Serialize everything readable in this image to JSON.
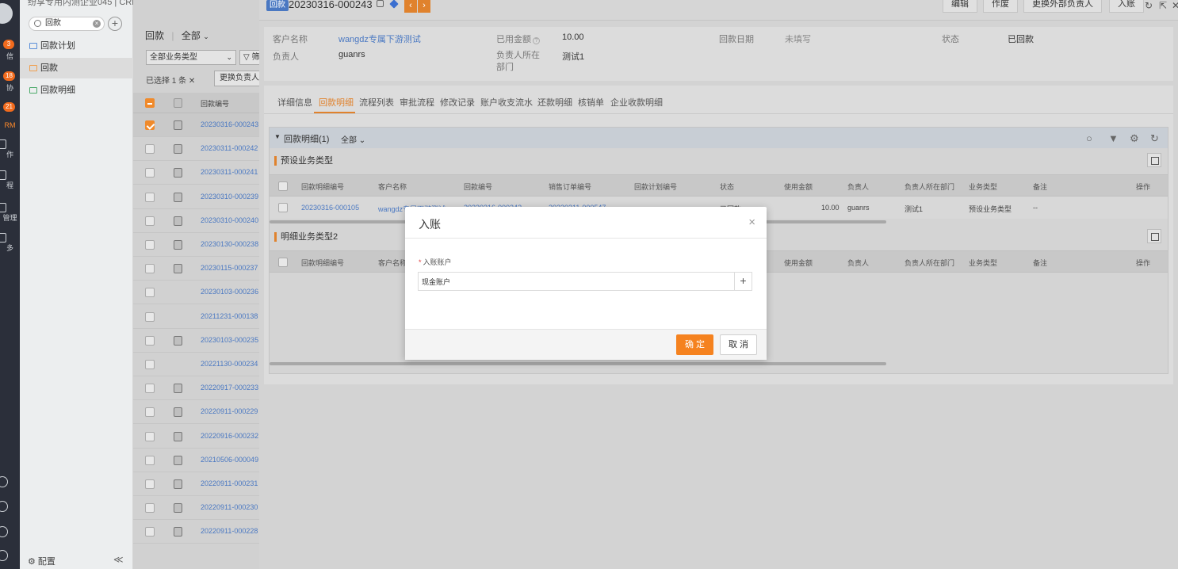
{
  "rail": {
    "items": [
      {
        "label": "信",
        "badge": "3"
      },
      {
        "label": "协",
        "badge": "18"
      },
      {
        "label": "RM",
        "badge": "21"
      },
      {
        "label": "作",
        "badge": ""
      },
      {
        "label": "程",
        "badge": ""
      },
      {
        "label": "管理",
        "badge": ""
      },
      {
        "label": "多",
        "badge": ""
      }
    ]
  },
  "nav": {
    "crumb": "纷享专用内测企业045  |  CRM",
    "search_value": "回款",
    "items": [
      {
        "label": "回款计划"
      },
      {
        "label": "回款"
      },
      {
        "label": "回款明细"
      }
    ],
    "config_label": "配置",
    "collapse_label": "≪"
  },
  "list": {
    "header_title": "回款",
    "scope": "全部",
    "type_select": "全部业务类型",
    "filter_label": "筛",
    "selected_text": "已选择 1 条",
    "change_owner": "更换负责人",
    "column": "回款编号",
    "rows": [
      {
        "no": "20230316-000243",
        "checked": true,
        "clip": true
      },
      {
        "no": "20230311-000242",
        "checked": false,
        "clip": true
      },
      {
        "no": "20230311-000241",
        "checked": false,
        "clip": true
      },
      {
        "no": "20230310-000239",
        "checked": false,
        "clip": true
      },
      {
        "no": "20230310-000240",
        "checked": false,
        "clip": true
      },
      {
        "no": "20230130-000238",
        "checked": false,
        "clip": true
      },
      {
        "no": "20230115-000237",
        "checked": false,
        "clip": true
      },
      {
        "no": "20230103-000236",
        "checked": false,
        "clip": false
      },
      {
        "no": "20211231-000138",
        "checked": false,
        "clip": false
      },
      {
        "no": "20230103-000235",
        "checked": false,
        "clip": true
      },
      {
        "no": "20221130-000234",
        "checked": false,
        "clip": false
      },
      {
        "no": "20220917-000233",
        "checked": false,
        "clip": true
      },
      {
        "no": "20220911-000229",
        "checked": false,
        "clip": true
      },
      {
        "no": "20220916-000232",
        "checked": false,
        "clip": true
      },
      {
        "no": "20210506-000049",
        "checked": false,
        "clip": true
      },
      {
        "no": "20220911-000231",
        "checked": false,
        "clip": true
      },
      {
        "no": "20220911-000230",
        "checked": false,
        "clip": true
      },
      {
        "no": "20220911-000228",
        "checked": false,
        "clip": true
      }
    ]
  },
  "detail": {
    "tag": "回款",
    "record_no": "20230316-000243",
    "actions": {
      "edit": "编辑",
      "void": "作废",
      "change_external": "更换外部负责人",
      "entry": "入账"
    },
    "info": {
      "customer_label": "客户名称",
      "customer_value": "wangdz专属下游测试",
      "owner_label": "负责人",
      "owner_value": "guanrs",
      "used_label": "已用金额",
      "used_value": "10.00",
      "dept_label": "负责人所在部门",
      "dept_value": "测试1",
      "date_label": "回款日期",
      "date_value": "未填写",
      "status_label": "状态",
      "status_value": "已回款"
    },
    "tabs": [
      "详细信息",
      "回款明细",
      "流程列表",
      "审批流程",
      "修改记录",
      "账户收支流水",
      "还款明细",
      "核销单",
      "企业收款明细"
    ],
    "section_title": "回款明细(1)",
    "section_scope": "全部",
    "group1": "预设业务类型",
    "group2": "明细业务类型2",
    "columns": [
      "回款明细编号",
      "客户名称",
      "回款编号",
      "销售订单编号",
      "回款计划编号",
      "状态",
      "使用金额",
      "负责人",
      "负责人所在部门",
      "业务类型",
      "备注",
      "操作"
    ],
    "row1": {
      "detail_no": "20230316-000105",
      "customer": "wangdz专属下游测试",
      "payment_no": "20230316-000243",
      "order_no": "20230311-000547",
      "plan_no": "",
      "status": "已回款",
      "amount": "10.00",
      "owner": "guanrs",
      "dept": "测试1",
      "biz_type": "预设业务类型",
      "remark": "--"
    }
  },
  "modal": {
    "title": "入账",
    "field_label": "入账账户",
    "field_value": "现金账户",
    "ok": "确 定",
    "cancel": "取 消"
  }
}
